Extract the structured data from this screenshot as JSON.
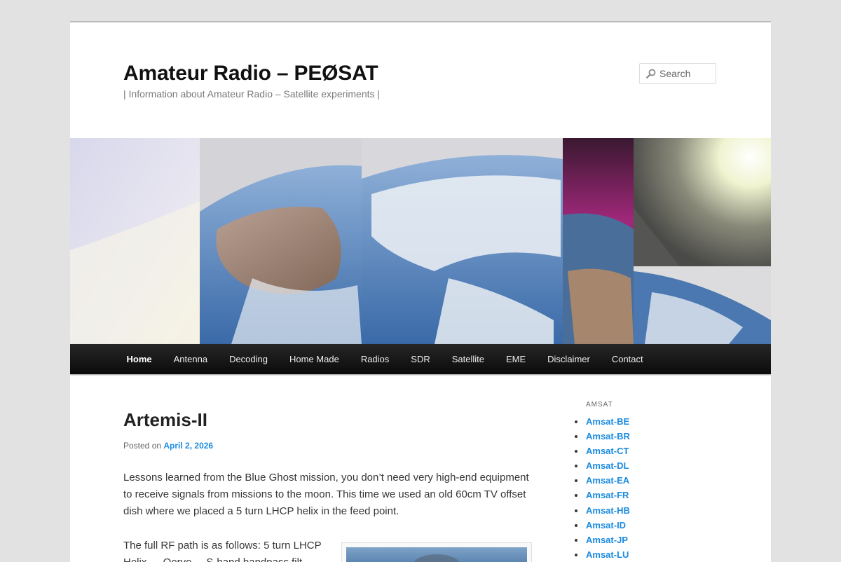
{
  "site": {
    "title": "Amateur Radio – PEØSAT",
    "description": "| Information about Amateur Radio – Satellite experiments |"
  },
  "search": {
    "placeholder": "Search",
    "icon": "magnifier-icon"
  },
  "nav": {
    "items": [
      {
        "label": "Home",
        "active": true
      },
      {
        "label": "Antenna"
      },
      {
        "label": "Decoding"
      },
      {
        "label": "Home Made"
      },
      {
        "label": "Radios"
      },
      {
        "label": "SDR"
      },
      {
        "label": "Satellite"
      },
      {
        "label": "EME"
      },
      {
        "label": "Disclaimer"
      },
      {
        "label": "Contact"
      }
    ]
  },
  "post": {
    "title": "Artemis-II",
    "posted_on_label": "Posted on",
    "date": "April 2, 2026",
    "paragraph1": "Lessons learned from the Blue Ghost mission, you don’t need very high-end equipment to receive signals from missions to the moon. This time we used an old 60cm TV offset dish where we placed a 5 turn LHCP helix in the feed point.",
    "paragraph2": "The full RF path is as follows: 5 turn LHCP Helix → Qorvo ... S-band bandpass filt..."
  },
  "sidebar": {
    "widget_title": "AMSAT",
    "links": [
      "Amsat-BE",
      "Amsat-BR",
      "Amsat-CT",
      "Amsat-DL",
      "Amsat-EA",
      "Amsat-FR",
      "Amsat-HB",
      "Amsat-ID",
      "Amsat-JP",
      "Amsat-LU"
    ]
  },
  "colors": {
    "link": "#1b8be0",
    "nav_bg": "#1a1a1a",
    "page_bg": "#e2e2e2"
  }
}
